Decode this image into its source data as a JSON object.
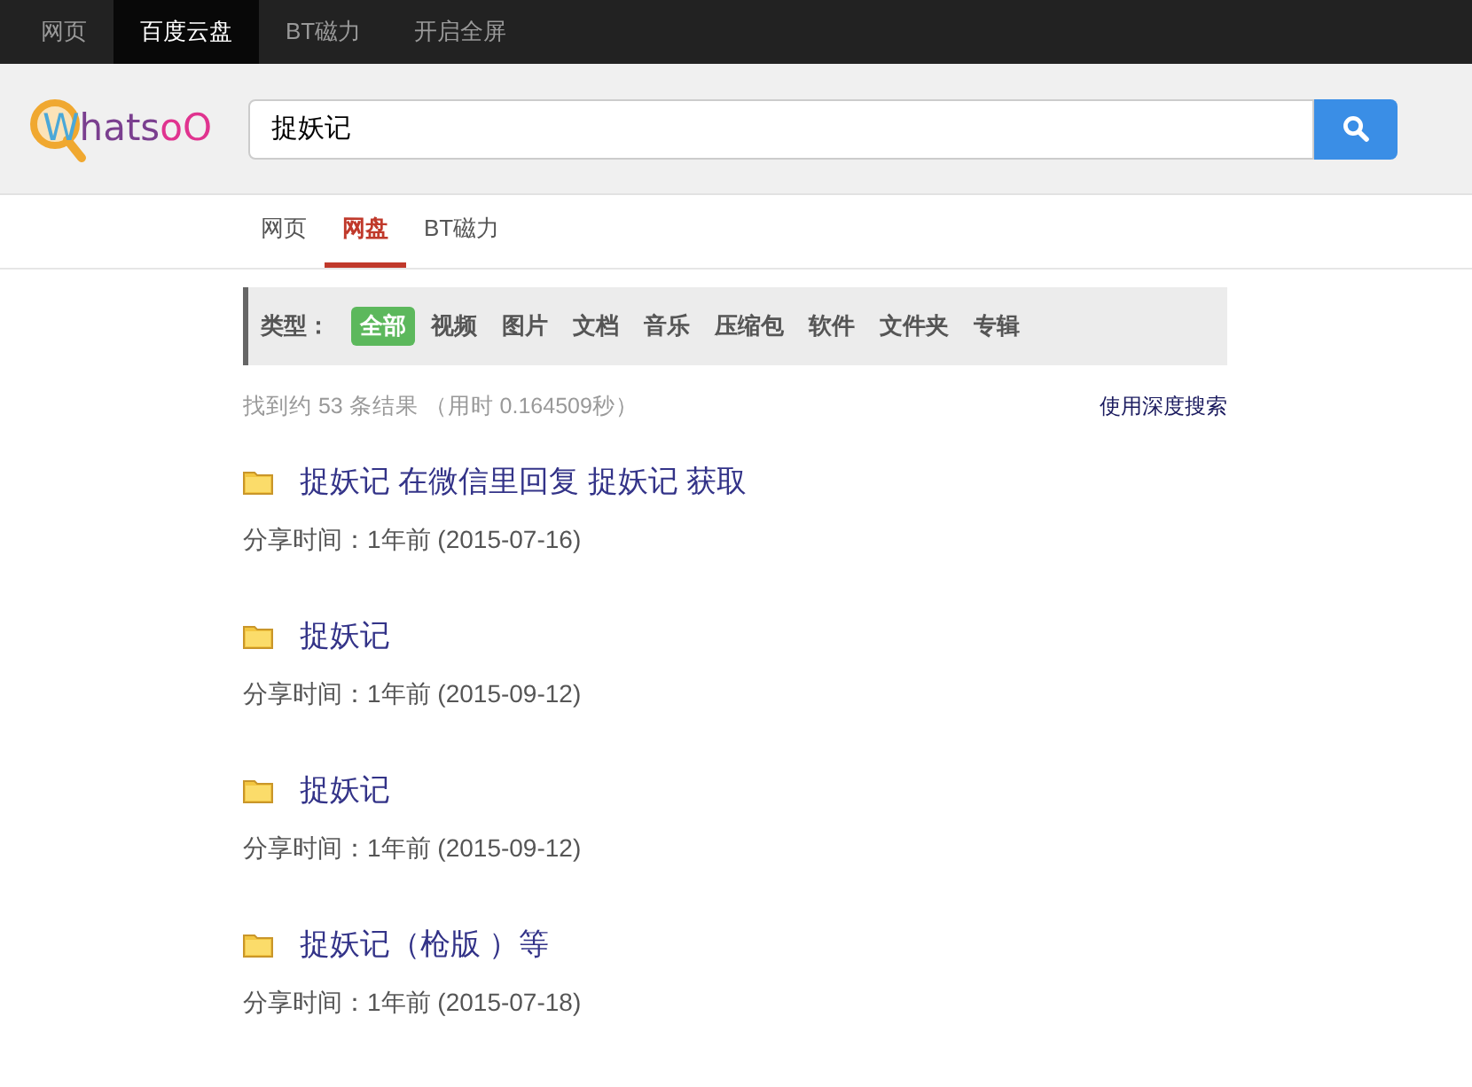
{
  "top_nav": [
    {
      "label": "网页",
      "selected": false
    },
    {
      "label": "百度云盘",
      "selected": true
    },
    {
      "label": "BT磁力",
      "selected": false
    },
    {
      "label": "开启全屏",
      "selected": false
    }
  ],
  "logo": {
    "parts": [
      "W",
      "hats",
      "oO"
    ]
  },
  "search": {
    "value": "捉妖记"
  },
  "tabs": [
    {
      "label": "网页",
      "selected": false
    },
    {
      "label": "网盘",
      "selected": true
    },
    {
      "label": "BT磁力",
      "selected": false
    }
  ],
  "filter": {
    "label": "类型：",
    "options": [
      {
        "label": "全部",
        "selected": true
      },
      {
        "label": "视频",
        "selected": false
      },
      {
        "label": "图片",
        "selected": false
      },
      {
        "label": "文档",
        "selected": false
      },
      {
        "label": "音乐",
        "selected": false
      },
      {
        "label": "压缩包",
        "selected": false
      },
      {
        "label": "软件",
        "selected": false
      },
      {
        "label": "文件夹",
        "selected": false
      },
      {
        "label": "专辑",
        "selected": false
      }
    ]
  },
  "stats": "找到约 53 条结果 （用时 0.164509秒）",
  "deep_search_link": "使用深度搜索",
  "results": [
    {
      "title": "捉妖记 在微信里回复 捉妖记 获取",
      "meta": "分享时间：1年前 (2015-07-16)"
    },
    {
      "title": "捉妖记",
      "meta": "分享时间：1年前 (2015-09-12)"
    },
    {
      "title": "捉妖记",
      "meta": "分享时间：1年前 (2015-09-12)"
    },
    {
      "title": "捉妖记（枪版 ）等",
      "meta": "分享时间：1年前 (2015-07-18)"
    }
  ]
}
